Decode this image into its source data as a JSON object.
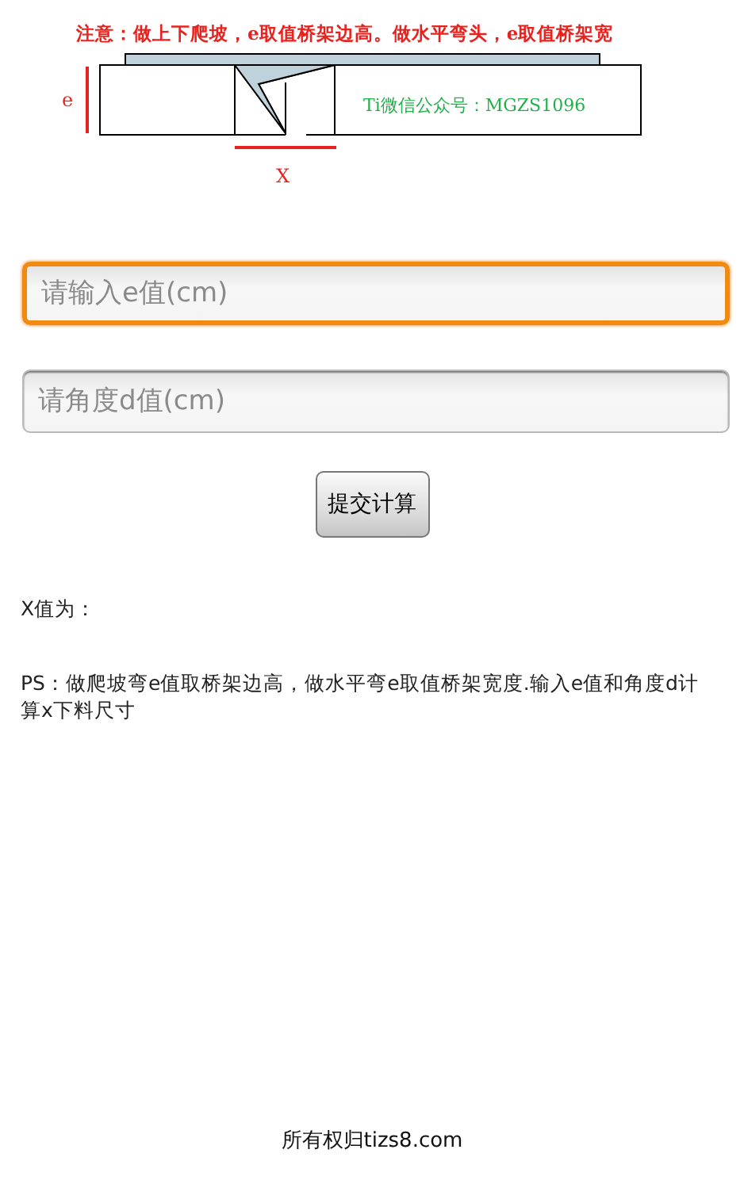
{
  "diagram": {
    "notice": "注意：做上下爬坡，e取值桥架边高。做水平弯头，e取值桥架宽",
    "height_label": "e",
    "length_label": "X",
    "caption": "Ti微信公众号：MGZS1096"
  },
  "fields": [
    {
      "placeholder": "请输入e值(cm)",
      "focused": true
    },
    {
      "placeholder": "请角度d值(cm)",
      "focused": false
    }
  ],
  "submit_button": "提交计算",
  "result_label": "X值为：",
  "note": "PS：做爬坡弯e值取桥架边高，做水平弯e取值桥架宽度.输入e值和角度d计算x下料尺寸",
  "footer": "所有权归tizs8.com"
}
